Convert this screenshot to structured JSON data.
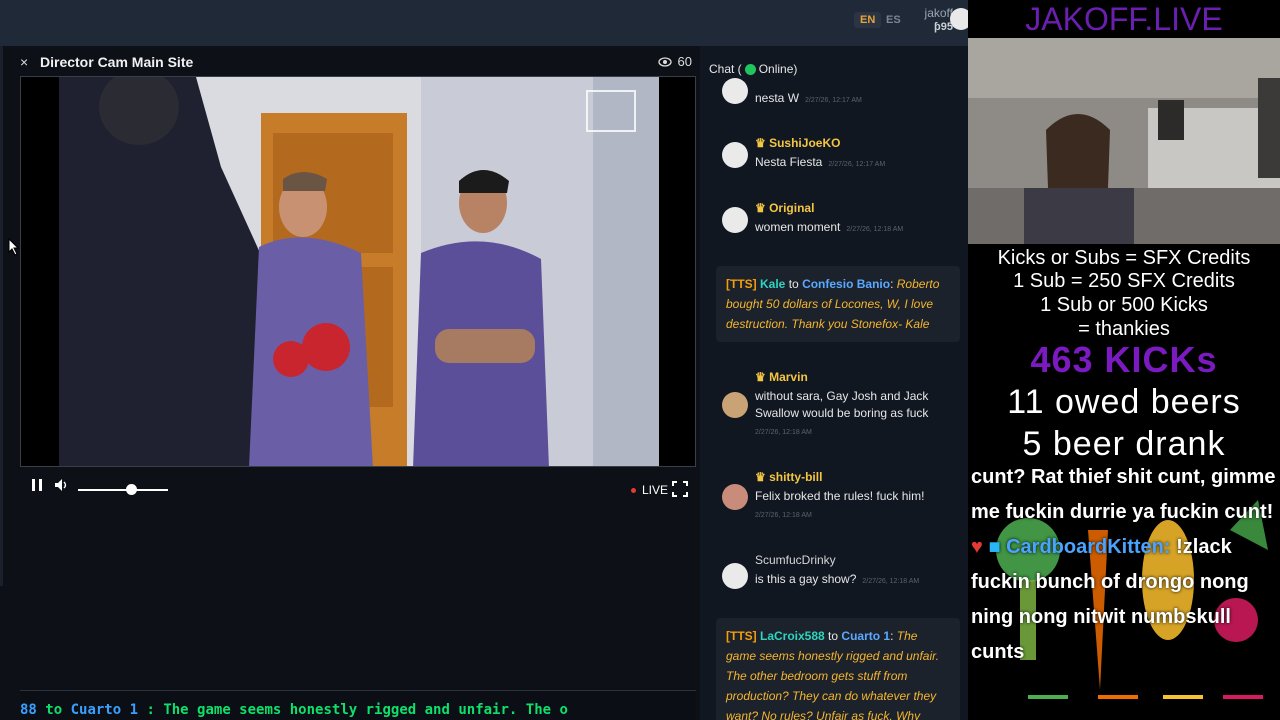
{
  "topbar": {
    "lang_en": "EN",
    "lang_es": "ES",
    "username": "jakoff",
    "coins": "ƥ95"
  },
  "player": {
    "close": "×",
    "title": "Director Cam Main Site",
    "viewers": "60",
    "live_label": "LIVE",
    "volume_level": 0.6
  },
  "ticker": {
    "prefix": "88",
    "to": "to",
    "room": "Cuarto 1",
    "text": ": The game seems honestly rigged and unfair. The o"
  },
  "chat": {
    "header_prefix": "Chat (",
    "header_status": "Online)",
    "messages": [
      {
        "name": "",
        "text": "nesta W",
        "time": "2/27/26, 12:17 AM"
      },
      {
        "name": "SushiJoeKO",
        "text": "Nesta Fiesta",
        "time": "2/27/26, 12:17 AM"
      },
      {
        "name": "Original",
        "text": "women moment",
        "time": "2/27/26, 12:18 AM"
      },
      {
        "name": "Marvin",
        "text": "without sara, Gay Josh and Jack Swallow would be boring as fuck",
        "time": "2/27/26, 12:18 AM"
      },
      {
        "name": "shitty-bill",
        "text": "Felix broked the rules! fuck him!",
        "time": "2/27/26, 12:18 AM"
      },
      {
        "name": "ScumfucDrinky",
        "text": "is this a gay show?",
        "time": "2/27/26, 12:18 AM"
      }
    ],
    "tts1": {
      "tag": "[TTS]",
      "from": "Kale",
      "to_word": "to",
      "to": "Confesio Banio",
      "body": "Roberto bought 50 dollars of Locones, W, I love destruction. Thank you Stonefox- Kale"
    },
    "tts2": {
      "tag": "[TTS]",
      "from": "LaCroix588",
      "to_word": "to",
      "to": "Cuarto 1",
      "body": "The game seems honestly rigged and unfair. The other bedroom gets stuff from production? They can do whatever they want? No rules? Unfair as fuck. Why"
    }
  },
  "stream": {
    "brand": "JAKOFF.LIVE",
    "line1": "Kicks or Subs = SFX Credits",
    "line2": "1 Sub = 250 SFX Credits",
    "line3": "1 Sub or 500 Kicks",
    "line4": "= thankies",
    "kicks": "463 KICKs",
    "beers": "11 owed beers",
    "drank": "5 beer drank",
    "caption_a": "cunt? Rat thief shit cunt, gimme me fuckin durrie ya fuckin cunt!",
    "caption_user": "CardboardKitten:",
    "caption_b": "!zlack fuckin bunch of drongo nong ning nong nitwit numbskull cunts"
  },
  "colors": {
    "accent_gold": "#f3c542",
    "online_green": "#21c55d",
    "brand_purple": "#6a1fb0"
  }
}
